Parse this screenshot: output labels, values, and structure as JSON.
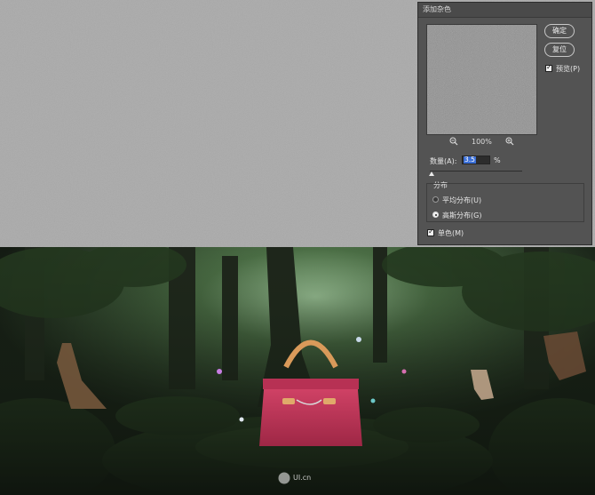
{
  "dialog": {
    "title": "添加杂色",
    "ok_label": "确定",
    "reset_label": "复位",
    "preview_label": "预览(P)",
    "preview_checked": true,
    "zoom_percent": "100%",
    "amount_label": "数量(A):",
    "amount_value": "3.5",
    "amount_unit": "%",
    "distribution_group_label": "分布",
    "distribution_options": [
      {
        "label": "平均分布(U)",
        "selected": false
      },
      {
        "label": "高斯分布(G)",
        "selected": true
      }
    ],
    "monochromatic_label": "单色(M)",
    "monochromatic_checked": true
  },
  "watermark": {
    "text": "UI.cn"
  },
  "colors": {
    "dialog_bg": "#535353",
    "canvas_gray": "#a9a9a9",
    "selection_blue": "#3b6fd6",
    "bag_pink": "#c93a5e"
  }
}
